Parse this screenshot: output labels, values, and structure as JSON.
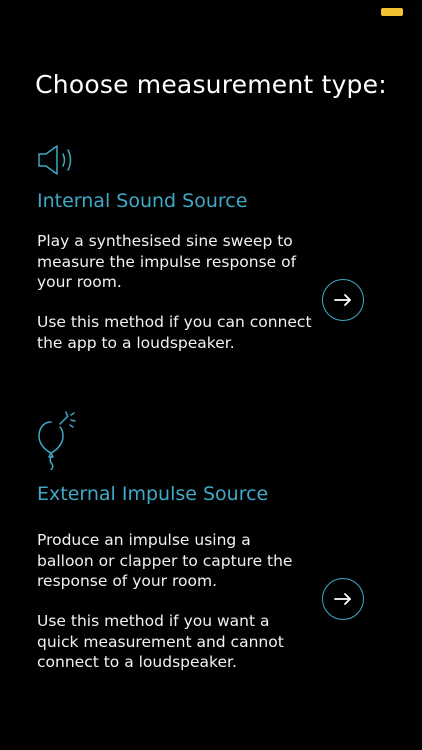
{
  "colors": {
    "accent": "#3fa9c8",
    "background": "#000000",
    "text": "#ffffff",
    "battery": "#f2c230"
  },
  "status_bar": {
    "battery_icon": "battery-icon"
  },
  "page_title": "Choose measurement type:",
  "options": [
    {
      "icon": "speaker-icon",
      "heading": "Internal Sound Source",
      "paragraph_1": "Play a synthesised sine sweep to measure the impulse response of your room.",
      "paragraph_2": "Use this method if you can connect the app to a loudspeaker.",
      "action_icon": "arrow-right-icon"
    },
    {
      "icon": "balloon-pop-icon",
      "heading": "External Impulse Source",
      "paragraph_1": "Produce an impulse using a balloon or clapper to capture the response of your room.",
      "paragraph_2": "Use this method if you want a quick measurement and cannot connect to a loudspeaker.",
      "action_icon": "arrow-right-icon"
    }
  ]
}
